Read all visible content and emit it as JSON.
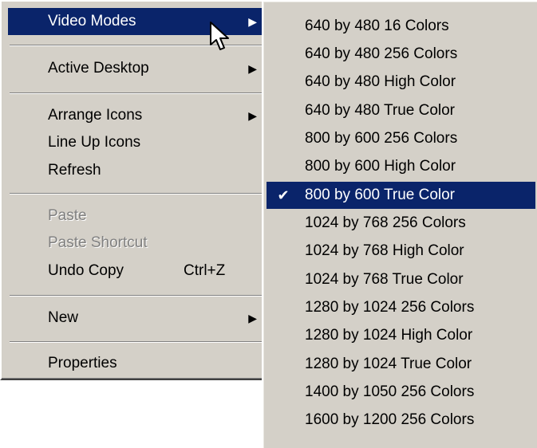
{
  "main_menu": {
    "items": [
      {
        "label": "Video Modes",
        "arrow": "▶"
      },
      {
        "label": "Active Desktop",
        "arrow": "▶"
      },
      {
        "label": "Arrange Icons",
        "arrow": "▶"
      },
      {
        "label": "Line Up Icons"
      },
      {
        "label": "Refresh"
      },
      {
        "label": "Paste"
      },
      {
        "label": "Paste Shortcut"
      },
      {
        "label": "Undo Copy",
        "shortcut": "Ctrl+Z"
      },
      {
        "label": "New",
        "arrow": "▶"
      },
      {
        "label": "Properties"
      }
    ]
  },
  "video_modes": {
    "check_mark": "✔",
    "items": [
      "640 by 480 16 Colors",
      "640 by 480 256 Colors",
      "640 by 480 High Color",
      "640 by 480 True Color",
      "800 by 600 256 Colors",
      "800 by 600 High Color",
      "800 by 600 True Color",
      "1024 by 768 256 Colors",
      "1024 by 768 High Color",
      "1024 by 768 True Color",
      "1280 by 1024 256 Colors",
      "1280 by 1024 High Color",
      "1280 by 1024 True Color",
      "1400 by 1050 256 Colors",
      "1600 by 1200 256 Colors"
    ]
  },
  "colors": {
    "menu_bg": "#d4d0c8",
    "highlight": "#0a246a",
    "disabled": "#808080"
  }
}
